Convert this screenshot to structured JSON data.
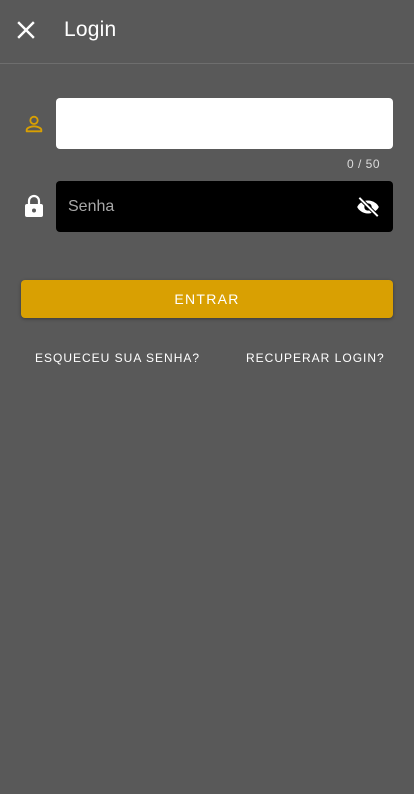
{
  "app_bar": {
    "title": "Login",
    "close_icon": "close-icon"
  },
  "form": {
    "login_field": {
      "icon": "person-outline-icon",
      "value": "",
      "placeholder": "",
      "counter": "0 / 50"
    },
    "password_field": {
      "icon": "lock-icon",
      "value": "",
      "placeholder": "Senha",
      "visibility_icon": "visibility-off-icon"
    },
    "submit_label": "ENTRAR"
  },
  "links": {
    "forgot_password": "ESQUECEU SUA SENHA?",
    "recover_login": "RECUPERAR LOGIN?"
  },
  "colors": {
    "background": "#595959",
    "accent": "#D9A002",
    "input_light": "#FFFFFF",
    "input_dark": "#000000"
  }
}
